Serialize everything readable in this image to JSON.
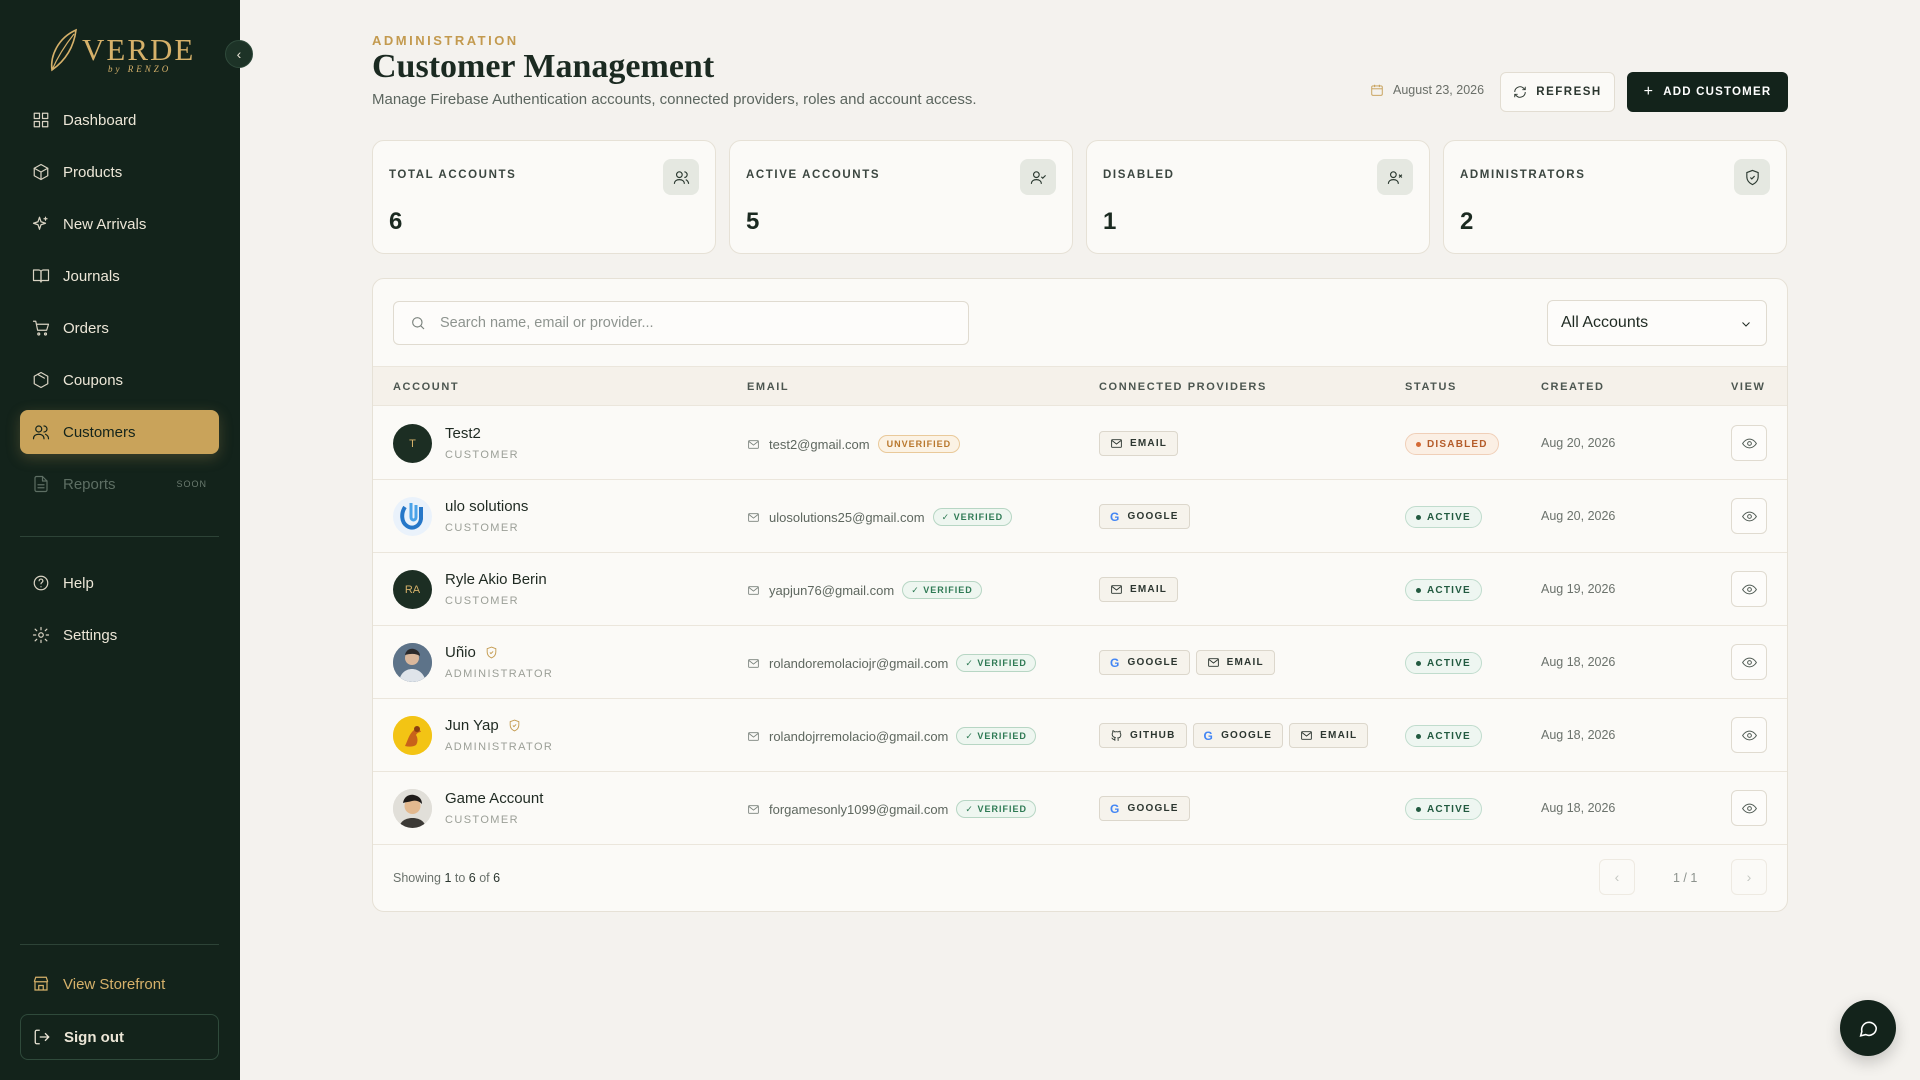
{
  "brand": {
    "name": "VERDE",
    "tagline": "by RENZO"
  },
  "sidebar": {
    "items": [
      {
        "label": "Dashboard",
        "icon": "dashboard-icon"
      },
      {
        "label": "Products",
        "icon": "box-icon"
      },
      {
        "label": "New Arrivals",
        "icon": "sparkles-icon"
      },
      {
        "label": "Journals",
        "icon": "book-icon"
      },
      {
        "label": "Orders",
        "icon": "cart-icon"
      },
      {
        "label": "Coupons",
        "icon": "tag-icon"
      },
      {
        "label": "Customers",
        "icon": "users-icon",
        "active": true
      },
      {
        "label": "Reports",
        "icon": "file-icon",
        "badge": "SOON",
        "disabled": true
      }
    ],
    "secondary": [
      {
        "label": "Help",
        "icon": "help-icon"
      },
      {
        "label": "Settings",
        "icon": "gear-icon"
      }
    ],
    "view_storefront": "View Storefront",
    "sign_out": "Sign out"
  },
  "header": {
    "eyebrow": "ADMINISTRATION",
    "title": "Customer Management",
    "subtitle": "Manage Firebase Authentication accounts, connected providers, roles and account access.",
    "date": "August 23, 2026",
    "refresh_label": "REFRESH",
    "add_label": "ADD CUSTOMER"
  },
  "stats": [
    {
      "label": "TOTAL ACCOUNTS",
      "value": "6",
      "icon": "users-icon"
    },
    {
      "label": "ACTIVE ACCOUNTS",
      "value": "5",
      "icon": "user-check-icon"
    },
    {
      "label": "DISABLED",
      "value": "1",
      "icon": "user-x-icon"
    },
    {
      "label": "ADMINISTRATORS",
      "value": "2",
      "icon": "shield-check-icon"
    }
  ],
  "table": {
    "search_placeholder": "Search name, email or provider...",
    "filter_value": "All Accounts",
    "columns": [
      "ACCOUNT",
      "EMAIL",
      "CONNECTED PROVIDERS",
      "STATUS",
      "CREATED",
      "VIEW"
    ],
    "rows": [
      {
        "initials": "T",
        "name": "Test2",
        "role": "CUSTOMER",
        "admin": false,
        "email": "test2@gmail.com",
        "verified_label": "UNVERIFIED",
        "verified": false,
        "providers": [
          "EMAIL"
        ],
        "status": "DISABLED",
        "created": "Aug 20, 2026"
      },
      {
        "initials": "",
        "name": "ulo solutions",
        "role": "CUSTOMER",
        "admin": false,
        "email": "ulosolutions25@gmail.com",
        "verified_label": "VERIFIED",
        "verified": true,
        "providers": [
          "GOOGLE"
        ],
        "status": "ACTIVE",
        "created": "Aug 20, 2026"
      },
      {
        "initials": "RA",
        "name": "Ryle Akio Berin",
        "role": "CUSTOMER",
        "admin": false,
        "email": "yapjun76@gmail.com",
        "verified_label": "VERIFIED",
        "verified": true,
        "providers": [
          "EMAIL"
        ],
        "status": "ACTIVE",
        "created": "Aug 19, 2026"
      },
      {
        "initials": "",
        "name": "Uñio",
        "role": "ADMINISTRATOR",
        "admin": true,
        "email": "rolandoremolaciojr@gmail.com",
        "verified_label": "VERIFIED",
        "verified": true,
        "providers": [
          "GOOGLE",
          "EMAIL"
        ],
        "status": "ACTIVE",
        "created": "Aug 18, 2026"
      },
      {
        "initials": "",
        "name": "Jun Yap",
        "role": "ADMINISTRATOR",
        "admin": true,
        "email": "rolandojrremolacio@gmail.com",
        "verified_label": "VERIFIED",
        "verified": true,
        "providers": [
          "GITHUB",
          "GOOGLE",
          "EMAIL"
        ],
        "status": "ACTIVE",
        "created": "Aug 18, 2026"
      },
      {
        "initials": "",
        "name": "Game Account",
        "role": "CUSTOMER",
        "admin": false,
        "email": "forgamesonly1099@gmail.com",
        "verified_label": "VERIFIED",
        "verified": true,
        "providers": [
          "GOOGLE"
        ],
        "status": "ACTIVE",
        "created": "Aug 18, 2026"
      }
    ],
    "footer": {
      "showing_prefix": "Showing",
      "from": "1",
      "to_word": "to",
      "to": "6",
      "of_word": "of",
      "total": "6",
      "page_label": "1 / 1"
    }
  },
  "colors": {
    "sidebar_bg": "#13231b",
    "accent_gold": "#c9a35a",
    "active_green": "#225a40",
    "disabled_orange": "#d46a35"
  }
}
